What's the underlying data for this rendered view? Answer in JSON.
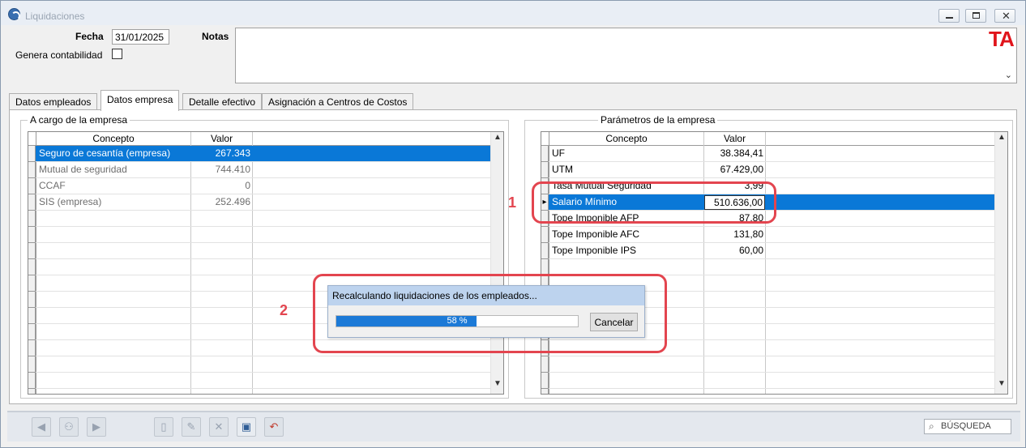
{
  "window": {
    "title": "Liquidaciones",
    "logo_text": "TA"
  },
  "form": {
    "fecha_label": "Fecha",
    "fecha_value": "31/01/2025",
    "genera_label": "Genera contabilidad",
    "genera_checked": false,
    "notas_label": "Notas",
    "notas_value": ""
  },
  "tabs": [
    {
      "label": "Datos empleados",
      "active": false
    },
    {
      "label": "Datos empresa",
      "active": true
    },
    {
      "label": "Detalle efectivo",
      "active": false
    },
    {
      "label": "Asignación a Centros de Costos",
      "active": false
    }
  ],
  "left_group": {
    "title": "A cargo de la empresa",
    "columns": [
      "Concepto",
      "Valor"
    ],
    "rows": [
      {
        "concepto": "Seguro de cesantía (empresa)",
        "valor": "267.343",
        "selected": true
      },
      {
        "concepto": "Mutual de seguridad",
        "valor": "744.410"
      },
      {
        "concepto": "CCAF",
        "valor": "0"
      },
      {
        "concepto": "SIS (empresa)",
        "valor": "252.496"
      }
    ]
  },
  "right_group": {
    "title": "Parámetros de la empresa",
    "columns": [
      "Concepto",
      "Valor"
    ],
    "rows": [
      {
        "concepto": "UF",
        "valor": "38.384,41"
      },
      {
        "concepto": "UTM",
        "valor": "67.429,00"
      },
      {
        "concepto": "Tasa Mutual Seguridad",
        "valor": "3,99"
      },
      {
        "concepto": "Salario Mínimo",
        "valor": "510.636,00",
        "selected": true
      },
      {
        "concepto": "Tope Imponible AFP",
        "valor": "87,80"
      },
      {
        "concepto": "Tope Imponible AFC",
        "valor": "131,80"
      },
      {
        "concepto": "Tope Imponible IPS",
        "valor": "60,00"
      }
    ]
  },
  "progress_dialog": {
    "message": "Recalculando liquidaciones de los empleados...",
    "percent": 58,
    "percent_text": "58 %",
    "cancel_label": "Cancelar"
  },
  "annotations": [
    {
      "number": "1"
    },
    {
      "number": "2"
    }
  ],
  "toolbar": {
    "search_label": "BÚSQUEDA"
  },
  "colors": {
    "selection": "#0a78d7",
    "annotation": "#e3454f",
    "logo": "#e0141b"
  }
}
